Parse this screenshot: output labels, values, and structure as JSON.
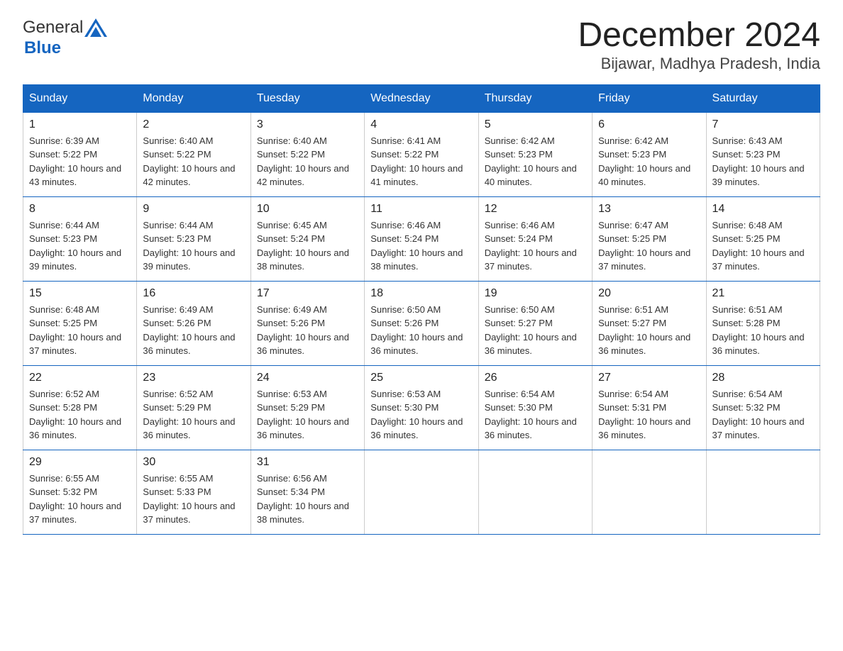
{
  "header": {
    "logo_general": "General",
    "logo_blue": "Blue",
    "title": "December 2024",
    "subtitle": "Bijawar, Madhya Pradesh, India"
  },
  "calendar": {
    "days_of_week": [
      "Sunday",
      "Monday",
      "Tuesday",
      "Wednesday",
      "Thursday",
      "Friday",
      "Saturday"
    ],
    "weeks": [
      [
        {
          "day": "1",
          "sunrise": "6:39 AM",
          "sunset": "5:22 PM",
          "daylight": "10 hours and 43 minutes."
        },
        {
          "day": "2",
          "sunrise": "6:40 AM",
          "sunset": "5:22 PM",
          "daylight": "10 hours and 42 minutes."
        },
        {
          "day": "3",
          "sunrise": "6:40 AM",
          "sunset": "5:22 PM",
          "daylight": "10 hours and 42 minutes."
        },
        {
          "day": "4",
          "sunrise": "6:41 AM",
          "sunset": "5:22 PM",
          "daylight": "10 hours and 41 minutes."
        },
        {
          "day": "5",
          "sunrise": "6:42 AM",
          "sunset": "5:23 PM",
          "daylight": "10 hours and 40 minutes."
        },
        {
          "day": "6",
          "sunrise": "6:42 AM",
          "sunset": "5:23 PM",
          "daylight": "10 hours and 40 minutes."
        },
        {
          "day": "7",
          "sunrise": "6:43 AM",
          "sunset": "5:23 PM",
          "daylight": "10 hours and 39 minutes."
        }
      ],
      [
        {
          "day": "8",
          "sunrise": "6:44 AM",
          "sunset": "5:23 PM",
          "daylight": "10 hours and 39 minutes."
        },
        {
          "day": "9",
          "sunrise": "6:44 AM",
          "sunset": "5:23 PM",
          "daylight": "10 hours and 39 minutes."
        },
        {
          "day": "10",
          "sunrise": "6:45 AM",
          "sunset": "5:24 PM",
          "daylight": "10 hours and 38 minutes."
        },
        {
          "day": "11",
          "sunrise": "6:46 AM",
          "sunset": "5:24 PM",
          "daylight": "10 hours and 38 minutes."
        },
        {
          "day": "12",
          "sunrise": "6:46 AM",
          "sunset": "5:24 PM",
          "daylight": "10 hours and 37 minutes."
        },
        {
          "day": "13",
          "sunrise": "6:47 AM",
          "sunset": "5:25 PM",
          "daylight": "10 hours and 37 minutes."
        },
        {
          "day": "14",
          "sunrise": "6:48 AM",
          "sunset": "5:25 PM",
          "daylight": "10 hours and 37 minutes."
        }
      ],
      [
        {
          "day": "15",
          "sunrise": "6:48 AM",
          "sunset": "5:25 PM",
          "daylight": "10 hours and 37 minutes."
        },
        {
          "day": "16",
          "sunrise": "6:49 AM",
          "sunset": "5:26 PM",
          "daylight": "10 hours and 36 minutes."
        },
        {
          "day": "17",
          "sunrise": "6:49 AM",
          "sunset": "5:26 PM",
          "daylight": "10 hours and 36 minutes."
        },
        {
          "day": "18",
          "sunrise": "6:50 AM",
          "sunset": "5:26 PM",
          "daylight": "10 hours and 36 minutes."
        },
        {
          "day": "19",
          "sunrise": "6:50 AM",
          "sunset": "5:27 PM",
          "daylight": "10 hours and 36 minutes."
        },
        {
          "day": "20",
          "sunrise": "6:51 AM",
          "sunset": "5:27 PM",
          "daylight": "10 hours and 36 minutes."
        },
        {
          "day": "21",
          "sunrise": "6:51 AM",
          "sunset": "5:28 PM",
          "daylight": "10 hours and 36 minutes."
        }
      ],
      [
        {
          "day": "22",
          "sunrise": "6:52 AM",
          "sunset": "5:28 PM",
          "daylight": "10 hours and 36 minutes."
        },
        {
          "day": "23",
          "sunrise": "6:52 AM",
          "sunset": "5:29 PM",
          "daylight": "10 hours and 36 minutes."
        },
        {
          "day": "24",
          "sunrise": "6:53 AM",
          "sunset": "5:29 PM",
          "daylight": "10 hours and 36 minutes."
        },
        {
          "day": "25",
          "sunrise": "6:53 AM",
          "sunset": "5:30 PM",
          "daylight": "10 hours and 36 minutes."
        },
        {
          "day": "26",
          "sunrise": "6:54 AM",
          "sunset": "5:30 PM",
          "daylight": "10 hours and 36 minutes."
        },
        {
          "day": "27",
          "sunrise": "6:54 AM",
          "sunset": "5:31 PM",
          "daylight": "10 hours and 36 minutes."
        },
        {
          "day": "28",
          "sunrise": "6:54 AM",
          "sunset": "5:32 PM",
          "daylight": "10 hours and 37 minutes."
        }
      ],
      [
        {
          "day": "29",
          "sunrise": "6:55 AM",
          "sunset": "5:32 PM",
          "daylight": "10 hours and 37 minutes."
        },
        {
          "day": "30",
          "sunrise": "6:55 AM",
          "sunset": "5:33 PM",
          "daylight": "10 hours and 37 minutes."
        },
        {
          "day": "31",
          "sunrise": "6:56 AM",
          "sunset": "5:34 PM",
          "daylight": "10 hours and 38 minutes."
        },
        null,
        null,
        null,
        null
      ]
    ]
  }
}
